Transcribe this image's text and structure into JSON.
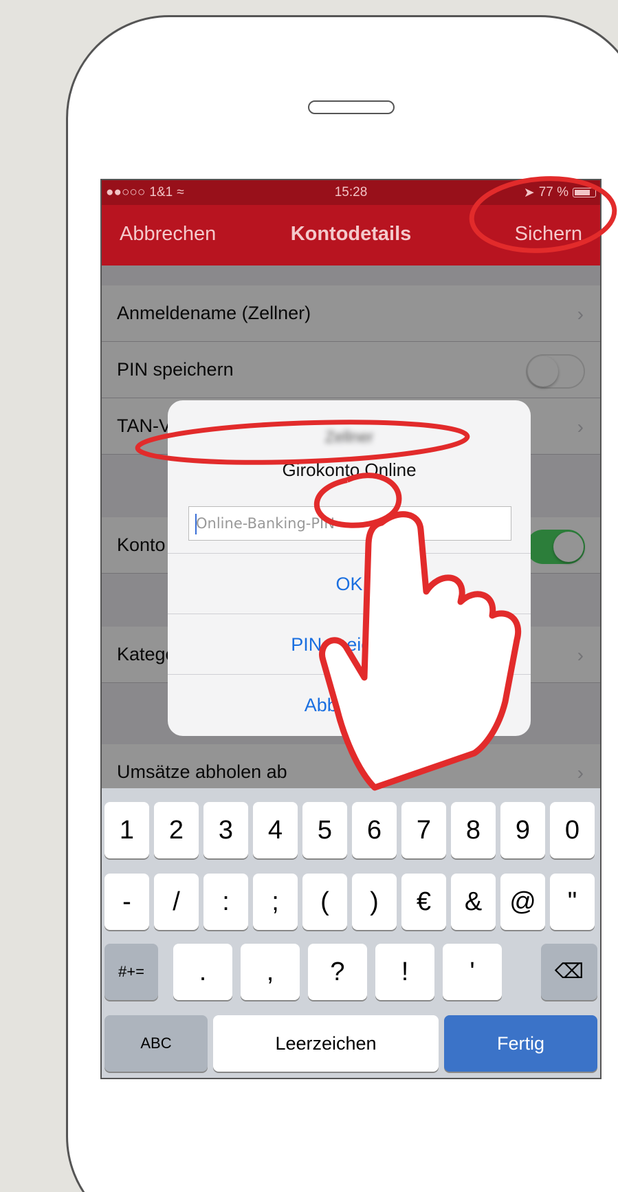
{
  "status_bar": {
    "carrier": "1&1",
    "time": "15:28",
    "battery": "77 %"
  },
  "nav": {
    "cancel": "Abbrechen",
    "title": "Kontodetails",
    "save": "Sichern"
  },
  "rows": {
    "login_name": "Anmeldename (Zellner)",
    "save_pin": "PIN speichern",
    "tan": "TAN-Verfahren",
    "account": "Konto aktiv",
    "category_rules": "Kategorieregeln",
    "fetch_transactions": "Umsätze abholen ab"
  },
  "alert": {
    "title": "Zellner",
    "message": "Girokonto Online",
    "pin_placeholder": "Online-Banking-PIN",
    "ok": "OK",
    "save_pin": "PIN speichern",
    "cancel": "Abbrechen"
  },
  "keyboard": {
    "row1": [
      "1",
      "2",
      "3",
      "4",
      "5",
      "6",
      "7",
      "8",
      "9",
      "0"
    ],
    "row2": [
      "-",
      "/",
      ":",
      ";",
      "(",
      ")",
      "€",
      "&",
      "@",
      "\""
    ],
    "row3": [
      ".",
      ",",
      "?",
      "!",
      "'"
    ],
    "symbols": "#+=",
    "abc": "ABC",
    "space": "Leerzeichen",
    "done": "Fertig"
  },
  "colors": {
    "accent": "#b81420",
    "annotation": "#e22b2b",
    "link": "#1a6fe0"
  }
}
